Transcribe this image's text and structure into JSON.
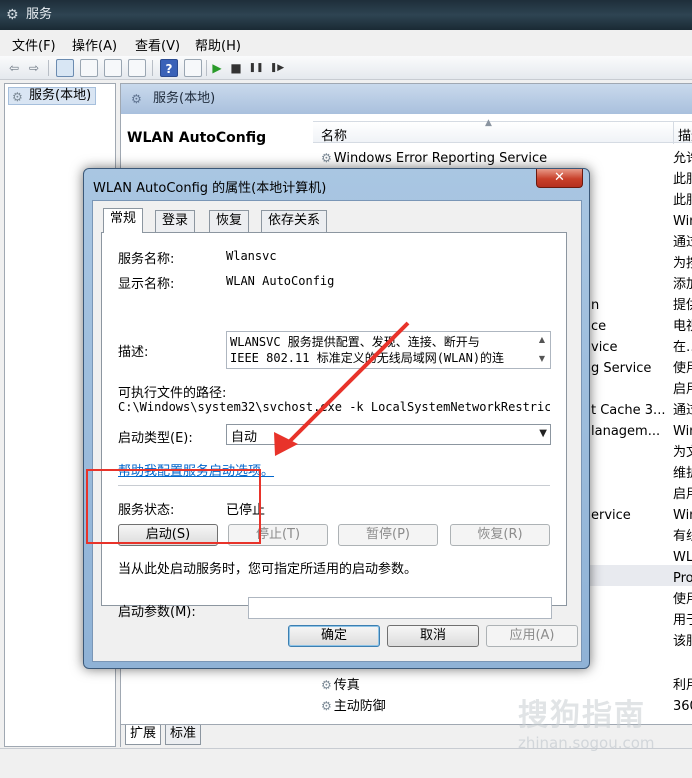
{
  "app": {
    "title": "服务"
  },
  "menu": [
    "文件(F)",
    "操作(A)",
    "查看(V)",
    "帮助(H)"
  ],
  "toolbar": {
    "back": "⇦",
    "forward": "⇨",
    "start": "▶",
    "stop": "■",
    "pause": "❚❚",
    "restart": "❚▶",
    "help": "?"
  },
  "tree": {
    "root": "服务(本地)"
  },
  "header": {
    "title": "服务(本地)"
  },
  "detail": {
    "service_name": "WLAN AutoConfig"
  },
  "columns": {
    "name": "名称",
    "desc": "描述"
  },
  "services": [
    {
      "name": "Windows Error Reporting Service",
      "desc": "允许"
    },
    {
      "name": "",
      "desc": "此服"
    },
    {
      "name": "",
      "desc": "此服"
    },
    {
      "name": "",
      "desc": "Win"
    },
    {
      "name": "",
      "desc": "通过"
    },
    {
      "name": "",
      "desc": "为按"
    },
    {
      "name": "",
      "desc": "添加"
    },
    {
      "name": "n",
      "desc": "提供"
    },
    {
      "name": "ce",
      "desc": "电视"
    },
    {
      "name": "vice",
      "desc": "在…"
    },
    {
      "name": "g Service",
      "desc": "使用"
    },
    {
      "name": "",
      "desc": "启用"
    },
    {
      "name": "t Cache 3...",
      "desc": "通过"
    },
    {
      "name": "lanagem...",
      "desc": "Win"
    },
    {
      "name": "",
      "desc": "为文"
    },
    {
      "name": "",
      "desc": "维护"
    },
    {
      "name": "",
      "desc": "启用"
    },
    {
      "name": "ervice",
      "desc": "Win"
    },
    {
      "name": "",
      "desc": "有线"
    },
    {
      "name": "",
      "desc": "WL"
    },
    {
      "name": "",
      "desc": "Pro"
    },
    {
      "name": "",
      "desc": "使用"
    },
    {
      "name": "",
      "desc": "用于"
    },
    {
      "name": "",
      "desc": "该服"
    },
    {
      "name": "传真",
      "desc": "利用"
    },
    {
      "name": "主动防御",
      "desc": "360"
    }
  ],
  "bottom_tabs": [
    "扩展",
    "标准"
  ],
  "dialog": {
    "title": "WLAN AutoConfig 的属性(本地计算机)",
    "close": "✕",
    "tabs": [
      "常规",
      "登录",
      "恢复",
      "依存关系"
    ],
    "service_name_label": "服务名称:",
    "service_name_value": "Wlansvc",
    "display_name_label": "显示名称:",
    "display_name_value": "WLAN AutoConfig",
    "description_label": "描述:",
    "description_line1": "WLANSVC 服务提供配置、发现、连接、断开与",
    "description_line2": "IEEE 802.11 标准定义的无线局域网(WLAN)的连",
    "exe_path_label": "可执行文件的路径:",
    "exe_path_value": "C:\\Windows\\system32\\svchost.exe -k LocalSystemNetworkRestric",
    "startup_type_label": "启动类型(E):",
    "startup_type_value": "自动",
    "help_link": "帮助我配置服务启动选项。",
    "status_label": "服务状态:",
    "status_value": "已停止",
    "btn_start": "启动(S)",
    "btn_stop": "停止(T)",
    "btn_pause": "暂停(P)",
    "btn_resume": "恢复(R)",
    "start_hint": "当从此处启动服务时，您可指定所适用的启动参数。",
    "start_params_label": "启动参数(M):",
    "start_params_value": "",
    "btn_ok": "确定",
    "btn_cancel": "取消",
    "btn_apply": "应用(A)"
  },
  "watermark": {
    "logo": "搜狗指南",
    "url": "zhinan.sogou.com"
  },
  "colors": {
    "annotation_red": "#e8332a",
    "link_blue": "#0066cc"
  }
}
